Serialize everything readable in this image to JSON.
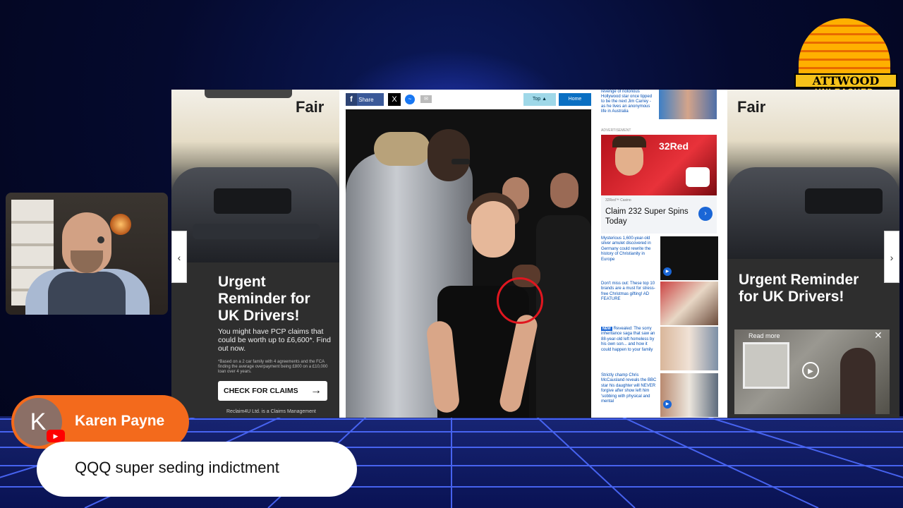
{
  "stream": {
    "logo": {
      "line1": "ATTWOOD",
      "line2": "UNLEASHED"
    },
    "host_name": "Karen Payne",
    "avatar_letter": "K",
    "platform_badge": "▶",
    "comment": "QQQ super seding indictment"
  },
  "browser": {
    "share_bar": {
      "facebook_icon": "f",
      "share_label": "Share",
      "x_icon": "X",
      "top_label": "Top",
      "home_label": "Home"
    },
    "left_ad": {
      "brand": "Fair",
      "headline": "Urgent Reminder for UK Drivers!",
      "body": "You might have PCP claims that could be worth up to £6,600*. Find out now.",
      "fine_print": "*Based on a 2 car family with 4 agreements and the FCA finding the average overpayment being £800 on a £10,000 loan over 4 years.",
      "cta": "CHECK FOR CLAIMS",
      "footer": "Reclaim4U Ltd. is a Claims Management"
    },
    "right_rail": {
      "top_story": "revenge of notorious Hollywood star once tipped to be the next Jim Carrey - as he lives an anonymous life in Australia",
      "ad_label": "ADVERTISEMENT",
      "casino_brand": "32Red",
      "casino_source": "32Red™ Casino",
      "casino_title": "Claim 232 Super Spins Today",
      "stories": [
        {
          "text": "Mysterious 1,600-year-old silver amulet discovered in Germany could rewrite the history of Christianity in Europe",
          "tag": ""
        },
        {
          "text": "Don't miss out: These top 10 brands are a must for stress-free Christmas gifting! AD FEATURE",
          "tag": ""
        },
        {
          "text": "Revealed: The sorry inheritance saga that saw an 88-year-old left homeless by his own son... and how it could happen to your family",
          "tag": "NEW"
        },
        {
          "text": "Strictly champ Chris McCausland reveals the BBC star his daughter will NEVER forgive after show left him 'sobbing with physical and mental",
          "tag": ""
        }
      ]
    },
    "right_ad": {
      "brand": "Fair",
      "headline": "Urgent Reminder for UK Drivers!",
      "video_label": "Read more"
    }
  }
}
